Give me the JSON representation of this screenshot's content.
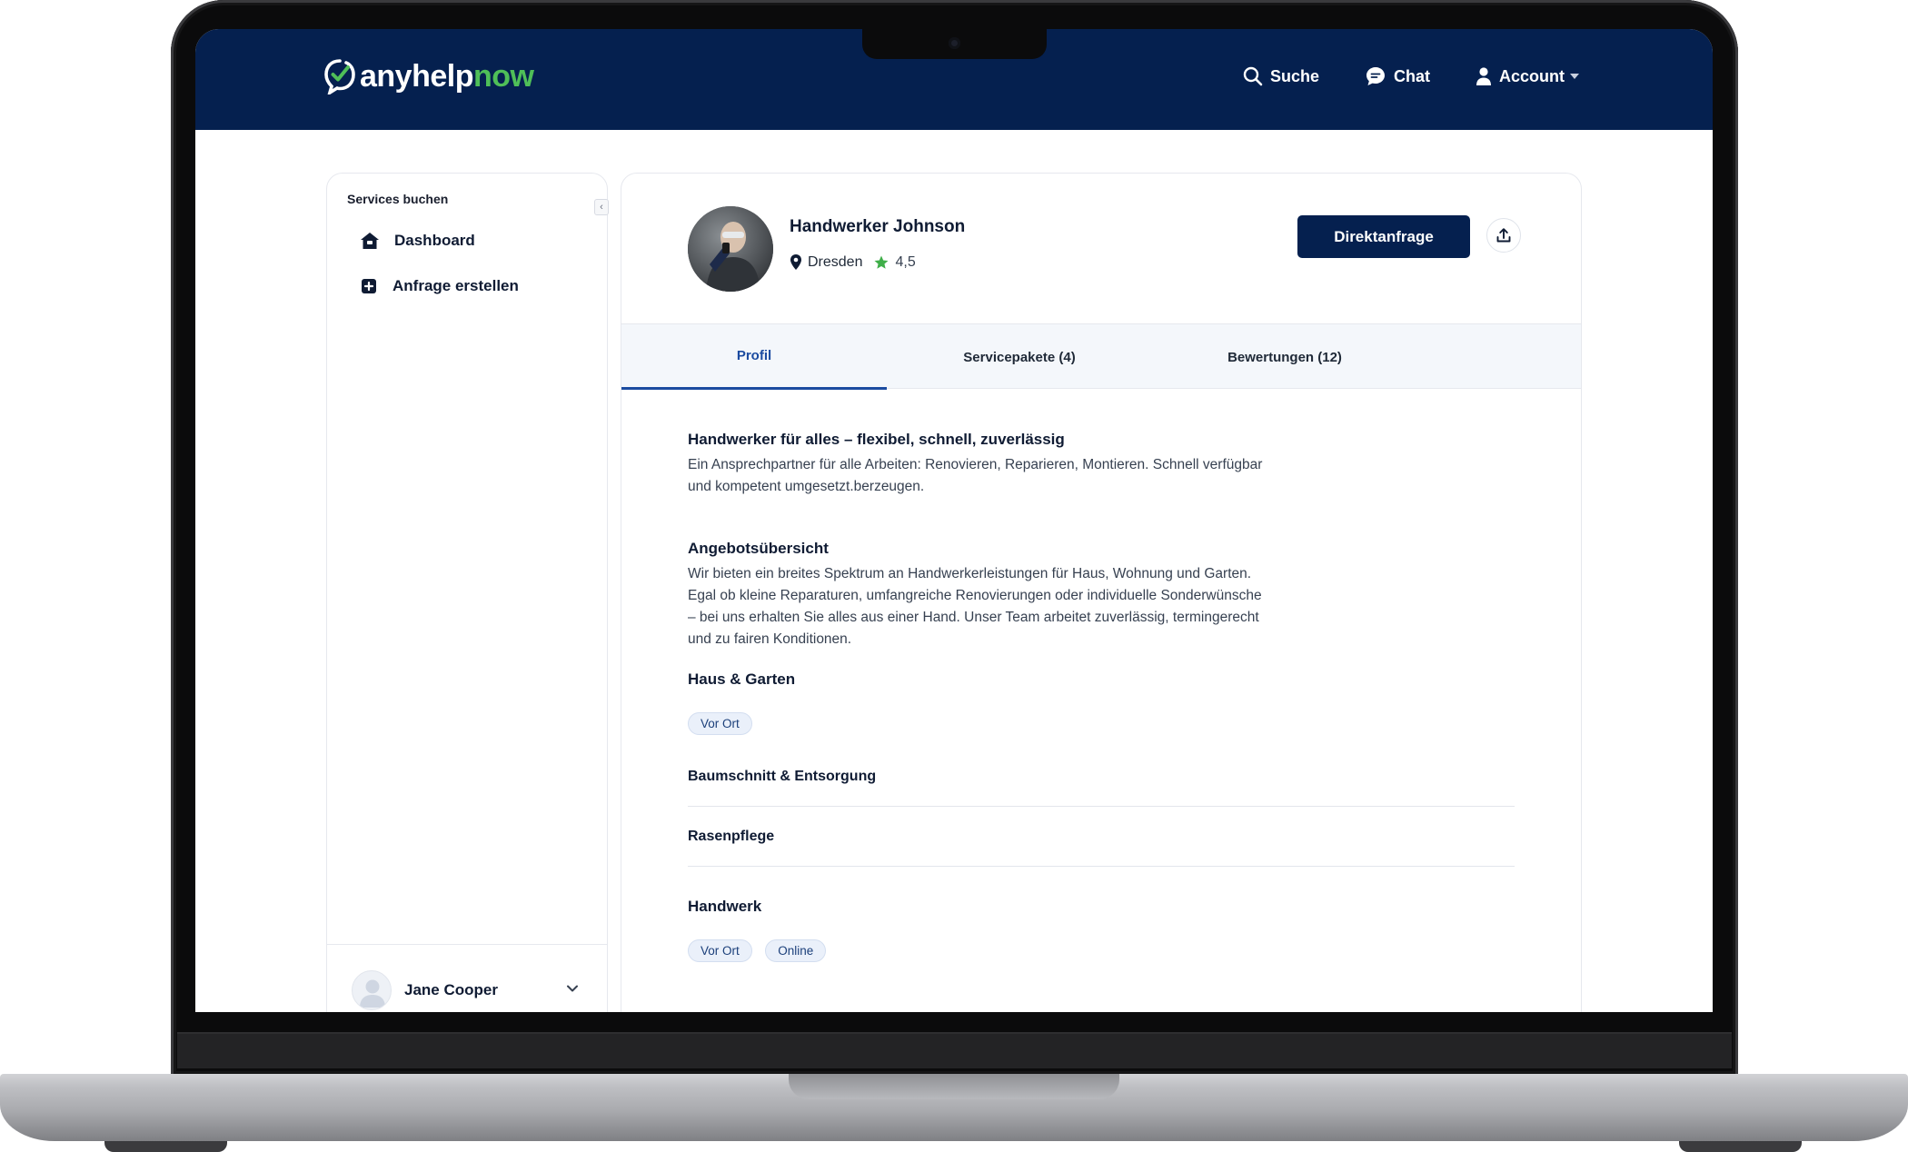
{
  "header": {
    "logo_main": "anyhelp",
    "logo_accent": "now",
    "nav": {
      "search": "Suche",
      "chat": "Chat",
      "account": "Account"
    }
  },
  "sidebar": {
    "title": "Services buchen",
    "items": [
      {
        "label": "Dashboard",
        "icon": "home-icon"
      },
      {
        "label": "Anfrage erstellen",
        "icon": "plus-square-icon"
      }
    ],
    "user": {
      "name": "Jane Cooper"
    }
  },
  "profile": {
    "name": "Handwerker Johnson",
    "location": "Dresden",
    "rating": "4,5",
    "cta": "Direktanfrage"
  },
  "tabs": [
    {
      "label": "Profil",
      "active": true
    },
    {
      "label": "Servicepakete (4)",
      "active": false
    },
    {
      "label": "Bewertungen (12)",
      "active": false
    }
  ],
  "content": {
    "headline": "Handwerker für alles – flexibel, schnell, zuverlässig",
    "intro_line1": "Ein Ansprechpartner für alle Arbeiten: Renovieren, Reparieren, Montieren. Schnell verfügbar",
    "intro_line2": "und kompetent umgesetzt.berzeugen.",
    "overview_title": "Angebotsübersicht",
    "overview_line1": "Wir bieten ein breites Spektrum an Handwerkerleistungen für Haus, Wohnung und Garten.",
    "overview_line2": "Egal ob kleine Reparaturen, umfangreiche Renovierungen oder individuelle Sonderwünsche",
    "overview_line3": "– bei uns erhalten Sie alles aus einer Hand. Unser Team arbeitet zuverlässig, termingerecht",
    "overview_line4": "und zu fairen Konditionen.",
    "categories": [
      {
        "title": "Haus & Garten",
        "tags": [
          "Vor Ort"
        ],
        "services": [
          "Baumschnitt & Entsorgung",
          "Rasenpflege"
        ]
      },
      {
        "title": "Handwerk",
        "tags": [
          "Vor Ort",
          "Online"
        ],
        "services": []
      }
    ]
  },
  "colors": {
    "navy": "#05204f",
    "green": "#4fbf58",
    "tab_active": "#1b4ba0"
  }
}
